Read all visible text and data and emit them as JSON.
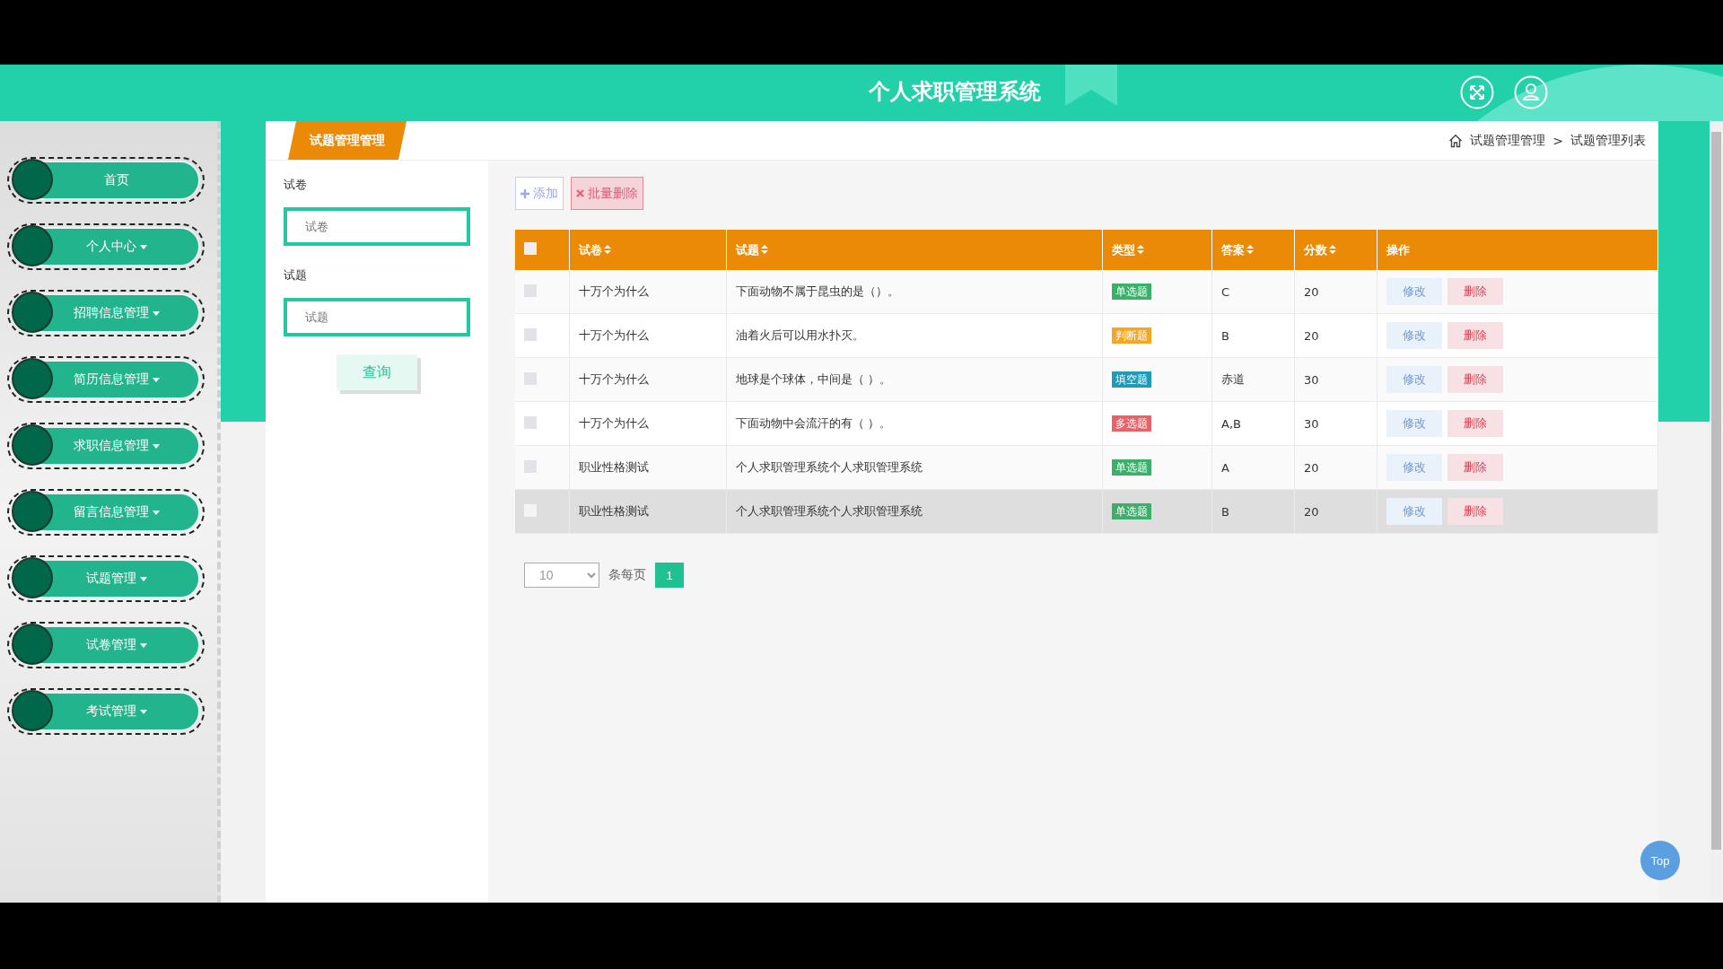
{
  "header": {
    "title": "个人求职管理系统"
  },
  "sidebar": {
    "items": [
      {
        "label": "首页",
        "expandable": false
      },
      {
        "label": "个人中心",
        "expandable": true
      },
      {
        "label": "招聘信息管理",
        "expandable": true
      },
      {
        "label": "简历信息管理",
        "expandable": true
      },
      {
        "label": "求职信息管理",
        "expandable": true
      },
      {
        "label": "留言信息管理",
        "expandable": true
      },
      {
        "label": "试题管理",
        "expandable": true
      },
      {
        "label": "试卷管理",
        "expandable": true
      },
      {
        "label": "考试管理",
        "expandable": true
      }
    ]
  },
  "tab": {
    "label": "试题管理管理"
  },
  "breadcrumb": [
    "试题管理管理",
    "试题管理列表"
  ],
  "breadcrumb_separator": ">",
  "select_all_checked": false,
  "filters": [
    {
      "label": "试卷",
      "placeholder": "试卷"
    },
    {
      "label": "试题",
      "placeholder": "试题"
    }
  ],
  "search_button": "查询",
  "actions": {
    "add": "添加",
    "batch_delete": "批量删除"
  },
  "table": {
    "columns": [
      "试卷",
      "试题",
      "类型",
      "答案",
      "分数",
      "操作"
    ],
    "rows": [
      {
        "paper": "十万个为什么",
        "question": "下面动物不属于昆虫的是（）。",
        "type": "单选题",
        "color": "#3daf6b",
        "answer": "C",
        "score": "20",
        "checked": false,
        "highlighted": false,
        "edit": "修改",
        "delete": "删除"
      },
      {
        "paper": "十万个为什么",
        "question": "油着火后可以用水扑灭。",
        "type": "判断题",
        "color": "#f5a623",
        "answer": "B",
        "score": "20",
        "checked": false,
        "highlighted": false,
        "edit": "修改",
        "delete": "删除"
      },
      {
        "paper": "十万个为什么",
        "question": "地球是个球体，中间是（ ）。",
        "type": "填空题",
        "color": "#1f9bb8",
        "answer": "赤道",
        "score": "30",
        "checked": false,
        "highlighted": false,
        "edit": "修改",
        "delete": "删除"
      },
      {
        "paper": "十万个为什么",
        "question": "下面动物中会流汗的有（ ）。",
        "type": "多选题",
        "color": "#eb6168",
        "answer": "A,B",
        "score": "30",
        "checked": false,
        "highlighted": false,
        "edit": "修改",
        "delete": "删除"
      },
      {
        "paper": "职业性格测试",
        "question": "个人求职管理系统个人求职管理系统",
        "type": "单选题",
        "color": "#3daf6b",
        "answer": "A",
        "score": "20",
        "checked": false,
        "highlighted": false,
        "edit": "修改",
        "delete": "删除"
      },
      {
        "paper": "职业性格测试",
        "question": "个人求职管理系统个人求职管理系统",
        "type": "单选题",
        "color": "#3daf6b",
        "answer": "B",
        "score": "20",
        "checked": false,
        "highlighted": true,
        "edit": "修改",
        "delete": "删除"
      }
    ]
  },
  "pagination": {
    "page_size": "10",
    "per_page_label": "条每页",
    "pages": [
      {
        "label": "1",
        "selected": true
      }
    ]
  },
  "top_button": "Top"
}
